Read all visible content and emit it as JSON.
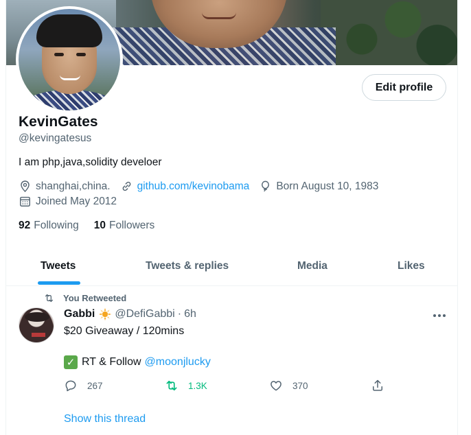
{
  "profile": {
    "edit_button": "Edit profile",
    "display_name": "KevinGates",
    "handle": "@kevingatesus",
    "bio": "I am php,java,solidity develoer",
    "location": "shanghai,china.",
    "website": "github.com/kevinobama",
    "birthday": "Born August 10, 1983",
    "joined": "Joined May 2012",
    "following_count": "92",
    "following_label": "Following",
    "followers_count": "10",
    "followers_label": "Followers"
  },
  "tabs": [
    {
      "label": "Tweets",
      "active": true
    },
    {
      "label": "Tweets & replies",
      "active": false
    },
    {
      "label": "Media",
      "active": false
    },
    {
      "label": "Likes",
      "active": false
    }
  ],
  "tweet": {
    "context": "You Retweeted",
    "author_name": "Gabbi",
    "author_handle": "@DefiGabbi",
    "separator": "·",
    "time": "6h",
    "line1": "$20 Giveaway / 120mins",
    "line2_text": "RT & Follow",
    "line2_mention": "@moonjlucky",
    "check_glyph": "✓",
    "replies": "267",
    "retweets": "1.3K",
    "likes": "370",
    "show_thread": "Show this thread"
  },
  "colors": {
    "accent": "#1d9bf0",
    "retweet_green": "#00ba7c",
    "muted_text": "#536471",
    "primary_text": "#0f1419"
  },
  "icons": {
    "location": "location-icon",
    "link": "link-icon",
    "birthday": "balloon-icon",
    "calendar": "calendar-icon",
    "retweet": "retweet-icon",
    "reply": "reply-icon",
    "like": "heart-icon",
    "share": "share-icon",
    "more": "more-icon",
    "verified_badge": "sun-badge-icon"
  }
}
